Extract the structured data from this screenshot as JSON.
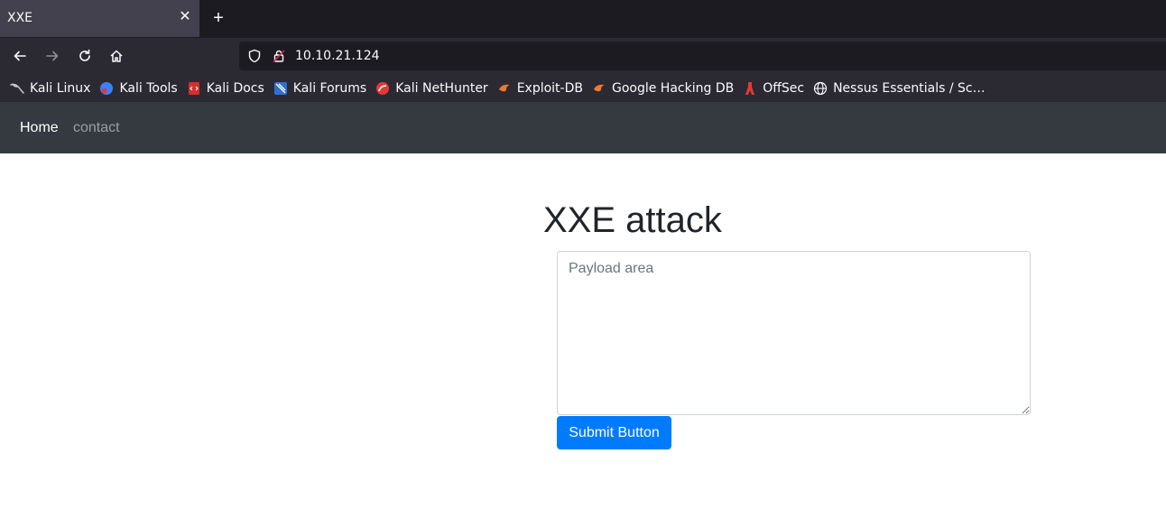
{
  "browser": {
    "tab": {
      "title": "XXE",
      "close_glyph": "✕"
    },
    "new_tab_glyph": "+",
    "url": "10.10.21.124"
  },
  "bookmarks": [
    {
      "label": "Kali Linux",
      "icon": "kali-dragon-icon",
      "color": "#367bf0"
    },
    {
      "label": "Kali Tools",
      "icon": "kali-tools-icon",
      "color": "#3b82f6"
    },
    {
      "label": "Kali Docs",
      "icon": "kali-docs-icon",
      "color": "#d32f2f"
    },
    {
      "label": "Kali Forums",
      "icon": "kali-forums-icon",
      "color": "#2f6fd0"
    },
    {
      "label": "Kali NetHunter",
      "icon": "nethunter-icon",
      "color": "#e53935"
    },
    {
      "label": "Exploit-DB",
      "icon": "exploit-db-icon",
      "color": "#f0792a"
    },
    {
      "label": "Google Hacking DB",
      "icon": "ghdb-icon",
      "color": "#f0792a"
    },
    {
      "label": "OffSec",
      "icon": "offsec-icon",
      "color": "#e53935"
    },
    {
      "label": "Nessus Essentials / Sc…",
      "icon": "globe-icon",
      "color": "#fbfbfe"
    }
  ],
  "site": {
    "nav": {
      "home": "Home",
      "contact": "contact"
    },
    "heading": "XXE attack",
    "payload_placeholder": "Payload area",
    "submit_label": "Submit Button"
  },
  "colors": {
    "primary": "#007bff",
    "navbar_dark": "#343a40",
    "browser_chrome": "#2b2a33"
  }
}
